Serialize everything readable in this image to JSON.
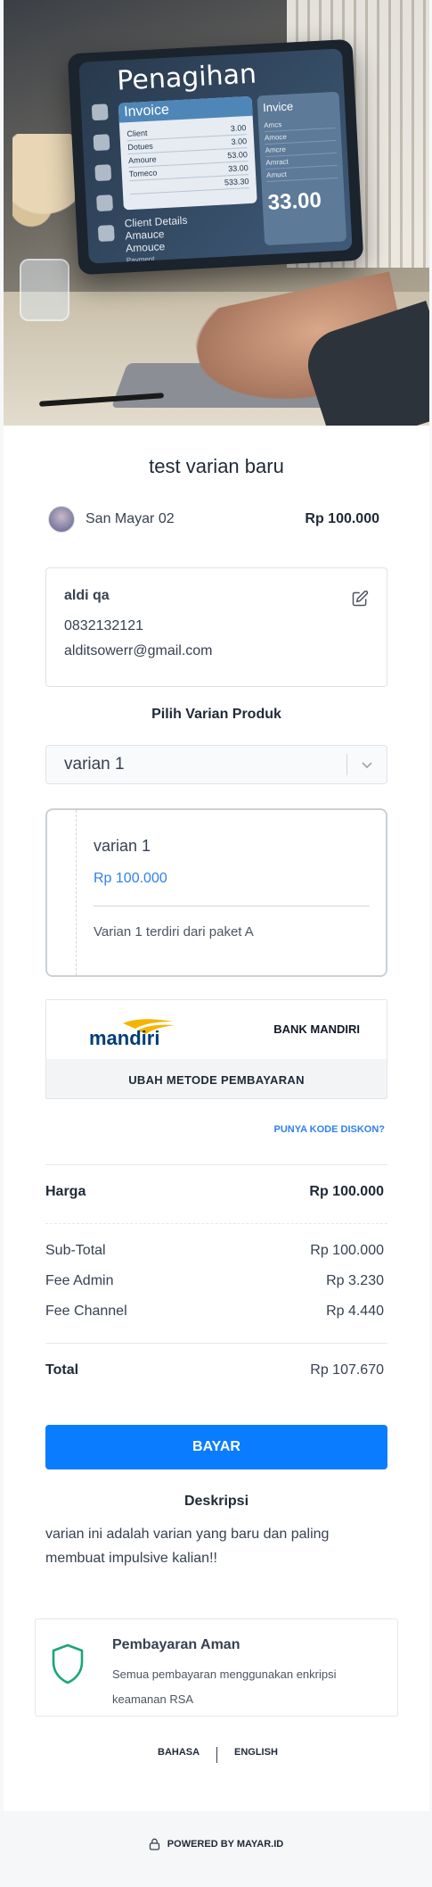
{
  "hero": {
    "screen_title": "Penagihan",
    "panel_header": "Invoice",
    "panel_rows": [
      {
        "label": "Client",
        "value": "3.00"
      },
      {
        "label": "Dotues",
        "value": "3.00"
      },
      {
        "label": "Amoure",
        "value": "53.00"
      },
      {
        "label": "Tomeco",
        "value": "33.00"
      }
    ],
    "panel_total": "533.30",
    "panel2_header": "Invice",
    "panel2_rows": [
      "Amcs",
      "Amoce",
      "Amcre",
      "Amract"
    ],
    "panel2_label": "Amuct",
    "panel2_big": "33.00",
    "details_title": "Client Details",
    "details_rows": [
      "Amauce",
      "Amouce"
    ],
    "details_side": "Payment"
  },
  "product": {
    "title": "test varian baru",
    "merchant_name": "San Mayar 02",
    "price": "Rp 100.000"
  },
  "customer": {
    "name": "aldi qa",
    "phone": "0832132121",
    "email": "alditsowerr@gmail.com"
  },
  "variant": {
    "heading": "Pilih Varian Produk",
    "selected": "varian 1",
    "card_name": "varian 1",
    "card_price": "Rp 100.000",
    "card_desc": "Varian 1 terdiri dari paket A"
  },
  "payment": {
    "logo_text": "mandiri",
    "bank_name": "BANK MANDIRI",
    "change_label": "UBAH METODE PEMBAYARAN",
    "discount_link": "PUNYA KODE DISKON?"
  },
  "summary": {
    "harga_label": "Harga",
    "harga_value": "Rp 100.000",
    "subtotal_label": "Sub-Total",
    "subtotal_value": "Rp 100.000",
    "fee_admin_label": "Fee Admin",
    "fee_admin_value": "Rp 3.230",
    "fee_channel_label": "Fee Channel",
    "fee_channel_value": "Rp 4.440",
    "total_label": "Total",
    "total_value": "Rp 107.670"
  },
  "actions": {
    "pay_label": "BAYAR"
  },
  "description": {
    "heading": "Deskripsi",
    "text": "varian ini adalah varian yang baru dan paling membuat impulsive kalian!!"
  },
  "secure": {
    "title": "Pembayaran Aman",
    "text": "Semua pembayaran menggunakan enkripsi keamanan RSA"
  },
  "language": {
    "label": "BAHASA",
    "value": "ENGLISH"
  },
  "footer": {
    "text": "POWERED BY MAYAR.ID"
  },
  "colors": {
    "primary": "#0a7cff",
    "link": "#2f80ed",
    "mandiri_blue": "#003d79",
    "mandiri_yellow": "#f5b400",
    "shield_green": "#1aa57a"
  }
}
